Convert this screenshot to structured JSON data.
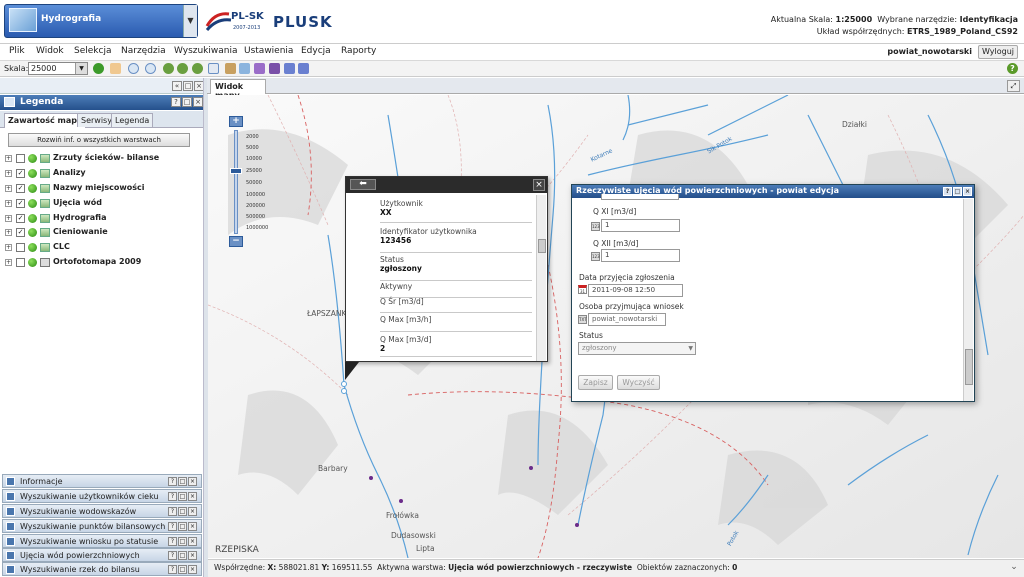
{
  "header": {
    "app_name": "Hydrografia",
    "logo_mark": "PL-SK",
    "logo_years": "2007-2013",
    "logo_title": "PLUSK",
    "scale_label": "Aktualna Skala:",
    "scale_value": "1:25000",
    "tool_label": "Wybrane narzędzie:",
    "tool_value": "Identyfikacja",
    "crs_label": "Układ współrzędnych:",
    "crs_value": "ETRS_1989_Poland_CS92"
  },
  "menu": {
    "items": [
      "Plik",
      "Widok",
      "Selekcja",
      "Narzędzia",
      "Wyszukiwania",
      "Ustawienia",
      "Edycja",
      "Raporty"
    ],
    "district": "powiat_nowotarski",
    "logout": "Wyloguj"
  },
  "toolbar": {
    "scale_label": "Skala:",
    "scale_value": "25000",
    "help": "?"
  },
  "legend": {
    "title": "Legenda",
    "tabs": [
      "Zawartość mapy",
      "Serwisy",
      "Legenda"
    ],
    "expand_button": "Rozwiń inf. o wszystkich warstwach",
    "layers": [
      {
        "label": "Zrzuty ścieków- bilanse",
        "checked": false
      },
      {
        "label": "Analizy",
        "checked": true
      },
      {
        "label": "Nazwy miejscowości",
        "checked": true
      },
      {
        "label": "Ujęcia wód",
        "checked": true
      },
      {
        "label": "Hydrografia",
        "checked": true
      },
      {
        "label": "Cieniowanie",
        "checked": true
      },
      {
        "label": "CLC",
        "checked": false
      },
      {
        "label": "Ortofotomapa 2009",
        "checked": false
      }
    ]
  },
  "bottom_panels": [
    "Informacje",
    "Wyszukiwanie użytkowników cieku",
    "Wyszukiwanie wodowskazów",
    "Wyszukiwanie punktów bilansowych",
    "Wyszukiwanie wniosku po statusie",
    "Ujęcia wód powierzchniowych",
    "Wyszukiwanie rzek do bilansu"
  ],
  "map": {
    "tab": "Widok mapy",
    "zoom_ticks": [
      "2000",
      "5000",
      "10000",
      "25000",
      "50000",
      "100000",
      "200000",
      "500000",
      "1000000"
    ],
    "labels": {
      "dzialki": "Działki",
      "lapszanka": "ŁAPSZANK",
      "barbary": "Barbary",
      "frolowka": "Frołówka",
      "dudasowski": "Dudasowski",
      "lipta": "Lipta",
      "rzepiska": "RZEPISKA"
    },
    "river_labels": {
      "kotarne": "Kotarne",
      "potok": "Sik Potok",
      "bottom": "Potok"
    }
  },
  "ident_popup": {
    "fields": [
      {
        "key": "Użytkownik",
        "value": "XX"
      },
      {
        "key": "Identyfikator użytkownika",
        "value": "123456"
      },
      {
        "key": "Status",
        "value": "zgłoszony"
      },
      {
        "key": "Aktywny",
        "value": ""
      },
      {
        "key": "Q Śr [m3/d]",
        "value": ""
      },
      {
        "key": "Q Max [m3/h]",
        "value": ""
      },
      {
        "key": "Q Max [m3/d]",
        "value": "2"
      }
    ]
  },
  "edit_window": {
    "title": "Rzeczywiste ujęcia wód powierzchniowych - powiat edycja",
    "q11_label": "Q XI [m3/d]",
    "q11_value": "1",
    "q12_label": "Q XII [m3/d]",
    "q12_value": "1",
    "date_label": "Data przyjęcia zgłoszenia",
    "date_value": "2011-09-08 12:50",
    "person_label": "Osoba przyjmująca wniosek",
    "person_value": "powiat_nowotarski",
    "status_label": "Status",
    "status_value": "zgłoszony",
    "save": "Zapisz",
    "clear": "Wyczyść",
    "num_icon": "123",
    "txt_icon": "TXT",
    "cal_icon": "31"
  },
  "statusbar": {
    "coords_label": "Współrzędne:",
    "x_label": "X:",
    "x_value": "588021.81",
    "y_label": "Y:",
    "y_value": "169511.55",
    "layer_label": "Aktywna warstwa:",
    "layer_value": "Ujęcia wód powierzchniowych - rzeczywiste",
    "selected_label": "Obiektów zaznaczonych:",
    "selected_value": "0"
  },
  "colors": {
    "accent": "#25508c",
    "river": "#5aa0d8",
    "boundary": "#d86060"
  }
}
